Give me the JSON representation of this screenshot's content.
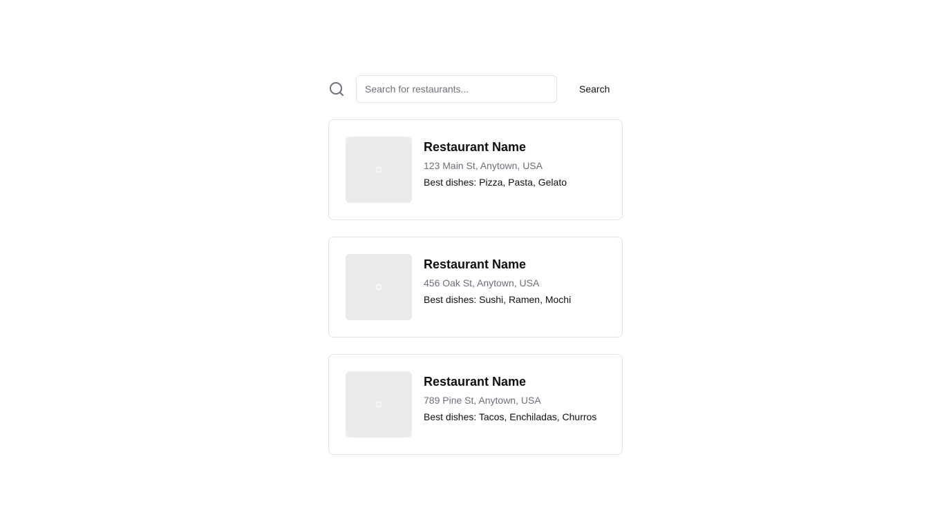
{
  "search": {
    "icon": "search-icon",
    "placeholder": "Search for restaurants...",
    "value": "",
    "button_label": "Search"
  },
  "restaurants": [
    {
      "name": "Restaurant Name",
      "address": "123 Main St, Anytown, USA",
      "dishes": "Best dishes: Pizza, Pasta, Gelato",
      "image": "image-placeholder"
    },
    {
      "name": "Restaurant Name",
      "address": "456 Oak St, Anytown, USA",
      "dishes": "Best dishes: Sushi, Ramen, Mochi",
      "image": "image-placeholder"
    },
    {
      "name": "Restaurant Name",
      "address": "789 Pine St, Anytown, USA",
      "dishes": "Best dishes: Tacos, Enchiladas, Churros",
      "image": "image-placeholder"
    }
  ],
  "colors": {
    "border": "#e3e3e6",
    "muted_text": "#6b6f78",
    "placeholder_bg": "#ebebeb",
    "text": "#0f0f10"
  }
}
